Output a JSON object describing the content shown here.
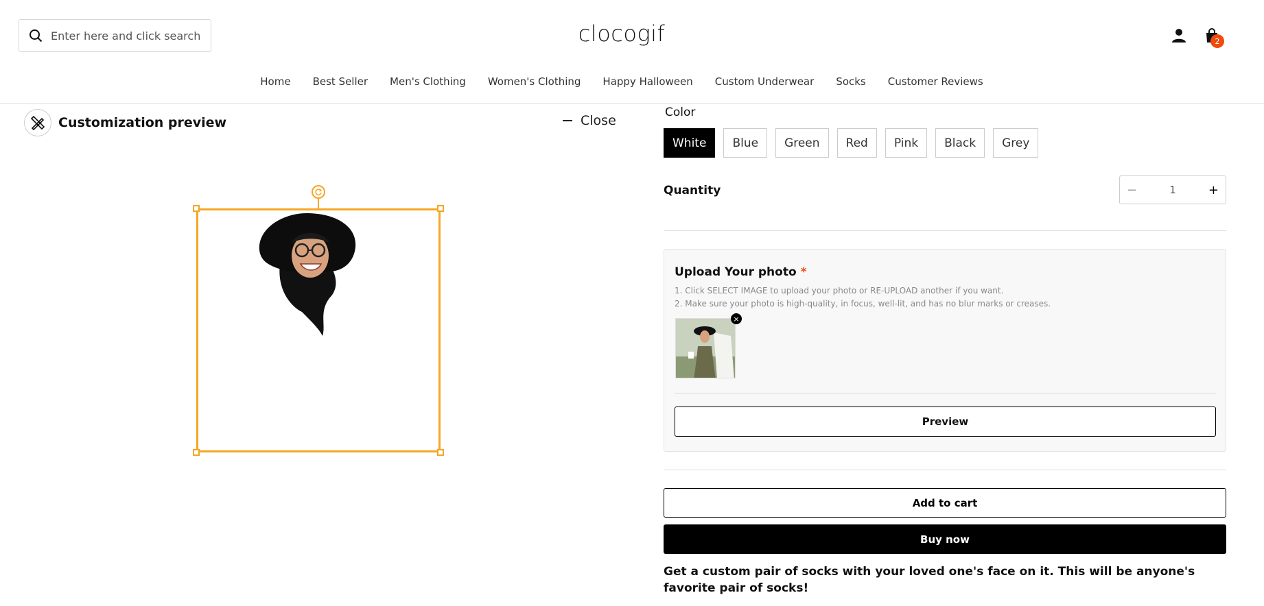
{
  "header": {
    "search_placeholder": "Enter here and click search",
    "logo": "clocogif",
    "cart_count": "2",
    "nav": [
      "Home",
      "Best Seller",
      "Men's Clothing",
      "Women's Clothing",
      "Happy Halloween",
      "Custom Underwear",
      "Socks",
      "Customer Reviews"
    ]
  },
  "preview": {
    "title": "Customization preview",
    "close_label": "Close"
  },
  "product": {
    "color_label": "Color",
    "colors": [
      "White",
      "Blue",
      "Green",
      "Red",
      "Pink",
      "Black",
      "Grey"
    ],
    "selected_color": "White",
    "quantity_label": "Quantity",
    "quantity_value": "1",
    "upload": {
      "title": "Upload Your photo",
      "required_mark": "*",
      "instruction_1": "1. Click SELECT IMAGE to upload your photo or RE-UPLOAD another if you want.",
      "instruction_2": "2. Make sure your photo is high-quality, in focus, well-lit, and has no blur marks or creases.",
      "preview_button": "Preview"
    },
    "add_to_cart": "Add to cart",
    "buy_now": "Buy now",
    "description": "Get a custom pair of socks with your loved one's face on it. This will be anyone's favorite pair of socks!"
  },
  "colors": {
    "accent_orange": "#f5a623",
    "badge": "#f04a0c",
    "primary": "#000000"
  }
}
